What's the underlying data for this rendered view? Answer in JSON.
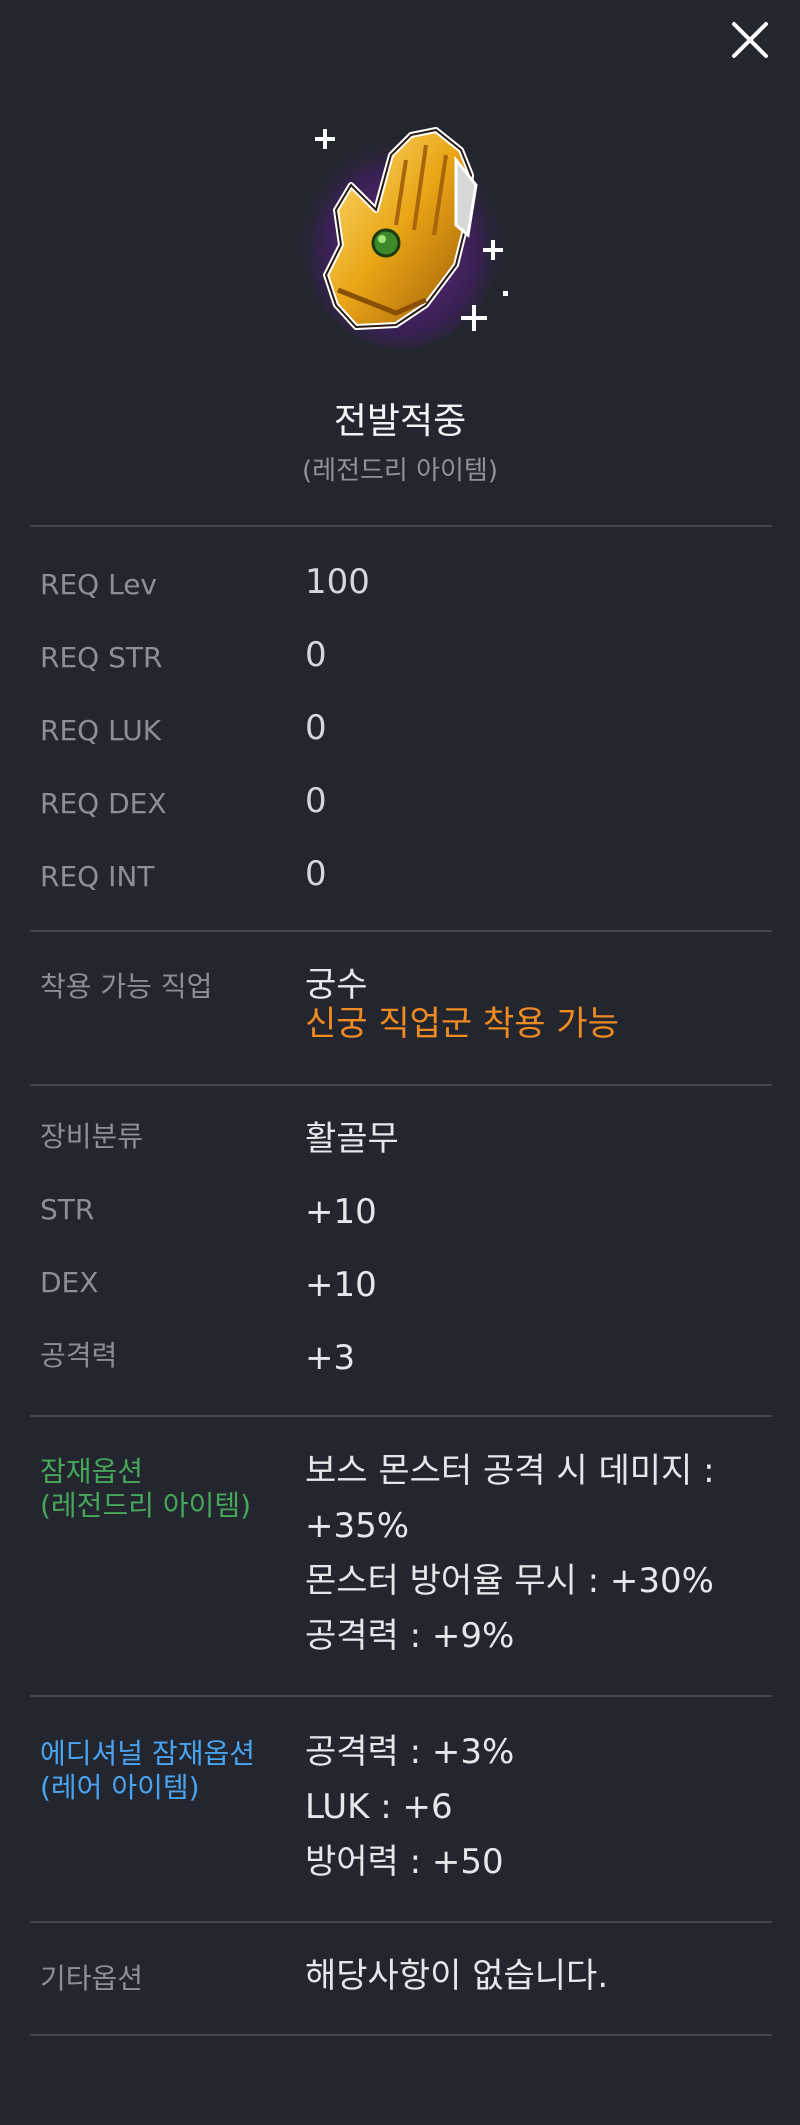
{
  "close_icon": "close-icon",
  "item": {
    "name": "전발적중",
    "grade": "(레전드리 아이템)",
    "icon": "golden-glove-icon"
  },
  "requirements": [
    {
      "label": "REQ Lev",
      "value": "100"
    },
    {
      "label": "REQ STR",
      "value": "0"
    },
    {
      "label": "REQ LUK",
      "value": "0"
    },
    {
      "label": "REQ DEX",
      "value": "0"
    },
    {
      "label": "REQ INT",
      "value": "0"
    }
  ],
  "job": {
    "label": "착용 가능 직업",
    "value": "궁수",
    "note": "신궁 직업군 착용 가능",
    "note_color": "#f08a22"
  },
  "stats": [
    {
      "label": "장비분류",
      "value": "활골무"
    },
    {
      "label": "STR",
      "value": "+10"
    },
    {
      "label": "DEX",
      "value": "+10"
    },
    {
      "label": "공격력",
      "value": "+3"
    }
  ],
  "potential": {
    "label_line1": "잠재옵션",
    "label_line2": "(레전드리 아이템)",
    "color": "#46a65a",
    "lines": [
      "보스 몬스터 공격 시 데미지 :",
      "+35%",
      "몬스터 방어율 무시 : +30%",
      "공격력 : +9%"
    ]
  },
  "additional": {
    "label_line1": "에디셔널 잠재옵션",
    "label_line2": "(레어 아이템)",
    "color": "#4aa3f0",
    "lines": [
      "공격력 : +3%",
      "LUK : +6",
      "방어력 : +50"
    ]
  },
  "etc": {
    "label": "기타옵션",
    "value": "해당사항이 없습니다."
  }
}
